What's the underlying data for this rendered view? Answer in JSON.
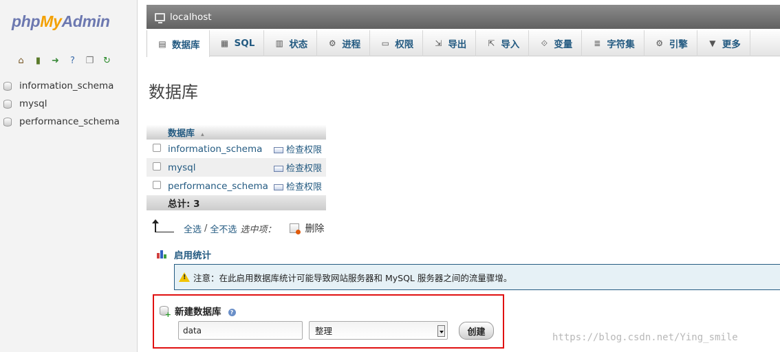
{
  "logo": {
    "php": "php",
    "my": "My",
    "admin": "Admin"
  },
  "nav_icons": [
    {
      "name": "home-icon",
      "glyph": "⌂",
      "color": "#7a5a2a"
    },
    {
      "name": "logout-icon",
      "glyph": "▮",
      "color": "#5a7a2a"
    },
    {
      "name": "query-icon",
      "glyph": "➜",
      "color": "#3a8a3a"
    },
    {
      "name": "docs-icon",
      "glyph": "?",
      "color": "#3a6aaa"
    },
    {
      "name": "copy-icon",
      "glyph": "❐",
      "color": "#777777"
    },
    {
      "name": "reload-icon",
      "glyph": "↻",
      "color": "#2a8a2a"
    }
  ],
  "db_tree": [
    "information_schema",
    "mysql",
    "performance_schema"
  ],
  "topbar": {
    "server": "localhost"
  },
  "tabs": [
    {
      "label": "数据库",
      "icon": "database-icon",
      "glyph": "▤",
      "active": true
    },
    {
      "label": "SQL",
      "icon": "sql-icon",
      "glyph": "▦",
      "active": false
    },
    {
      "label": "状态",
      "icon": "status-icon",
      "glyph": "▥",
      "active": false
    },
    {
      "label": "进程",
      "icon": "gear-icon",
      "glyph": "⚙",
      "active": false
    },
    {
      "label": "权限",
      "icon": "privileges-icon",
      "glyph": "▭",
      "active": false
    },
    {
      "label": "导出",
      "icon": "export-icon",
      "glyph": "⇲",
      "active": false
    },
    {
      "label": "导入",
      "icon": "import-icon",
      "glyph": "⇱",
      "active": false
    },
    {
      "label": "变量",
      "icon": "variables-icon",
      "glyph": "⟐",
      "active": false
    },
    {
      "label": "字符集",
      "icon": "charset-icon",
      "glyph": "≣",
      "active": false
    },
    {
      "label": "引擎",
      "icon": "engine-icon",
      "glyph": "⚙",
      "active": false
    },
    {
      "label": "更多",
      "icon": "chevron-down-icon",
      "glyph": "▼",
      "active": false
    }
  ],
  "page_title": "数据库",
  "db_table": {
    "header": "数据库",
    "rows": [
      {
        "name": "information_schema",
        "priv": "检查权限"
      },
      {
        "name": "mysql",
        "priv": "检查权限"
      },
      {
        "name": "performance_schema",
        "priv": "检查权限"
      }
    ],
    "total": "总计: 3"
  },
  "selection": {
    "check_all": "全选",
    "separator": "/",
    "uncheck_all": "全不选",
    "with_selected": "选中项：",
    "delete": "删除"
  },
  "stats": {
    "label": "启用统计"
  },
  "notice": "注意：在此启用数据库统计可能导致网站服务器和 MySQL 服务器之间的流量骤增。",
  "create_db": {
    "title": "新建数据库",
    "name_value": "data",
    "collation_value": "整理",
    "button": "创建"
  },
  "watermark": "https://blog.csdn.net/Ying_smile"
}
